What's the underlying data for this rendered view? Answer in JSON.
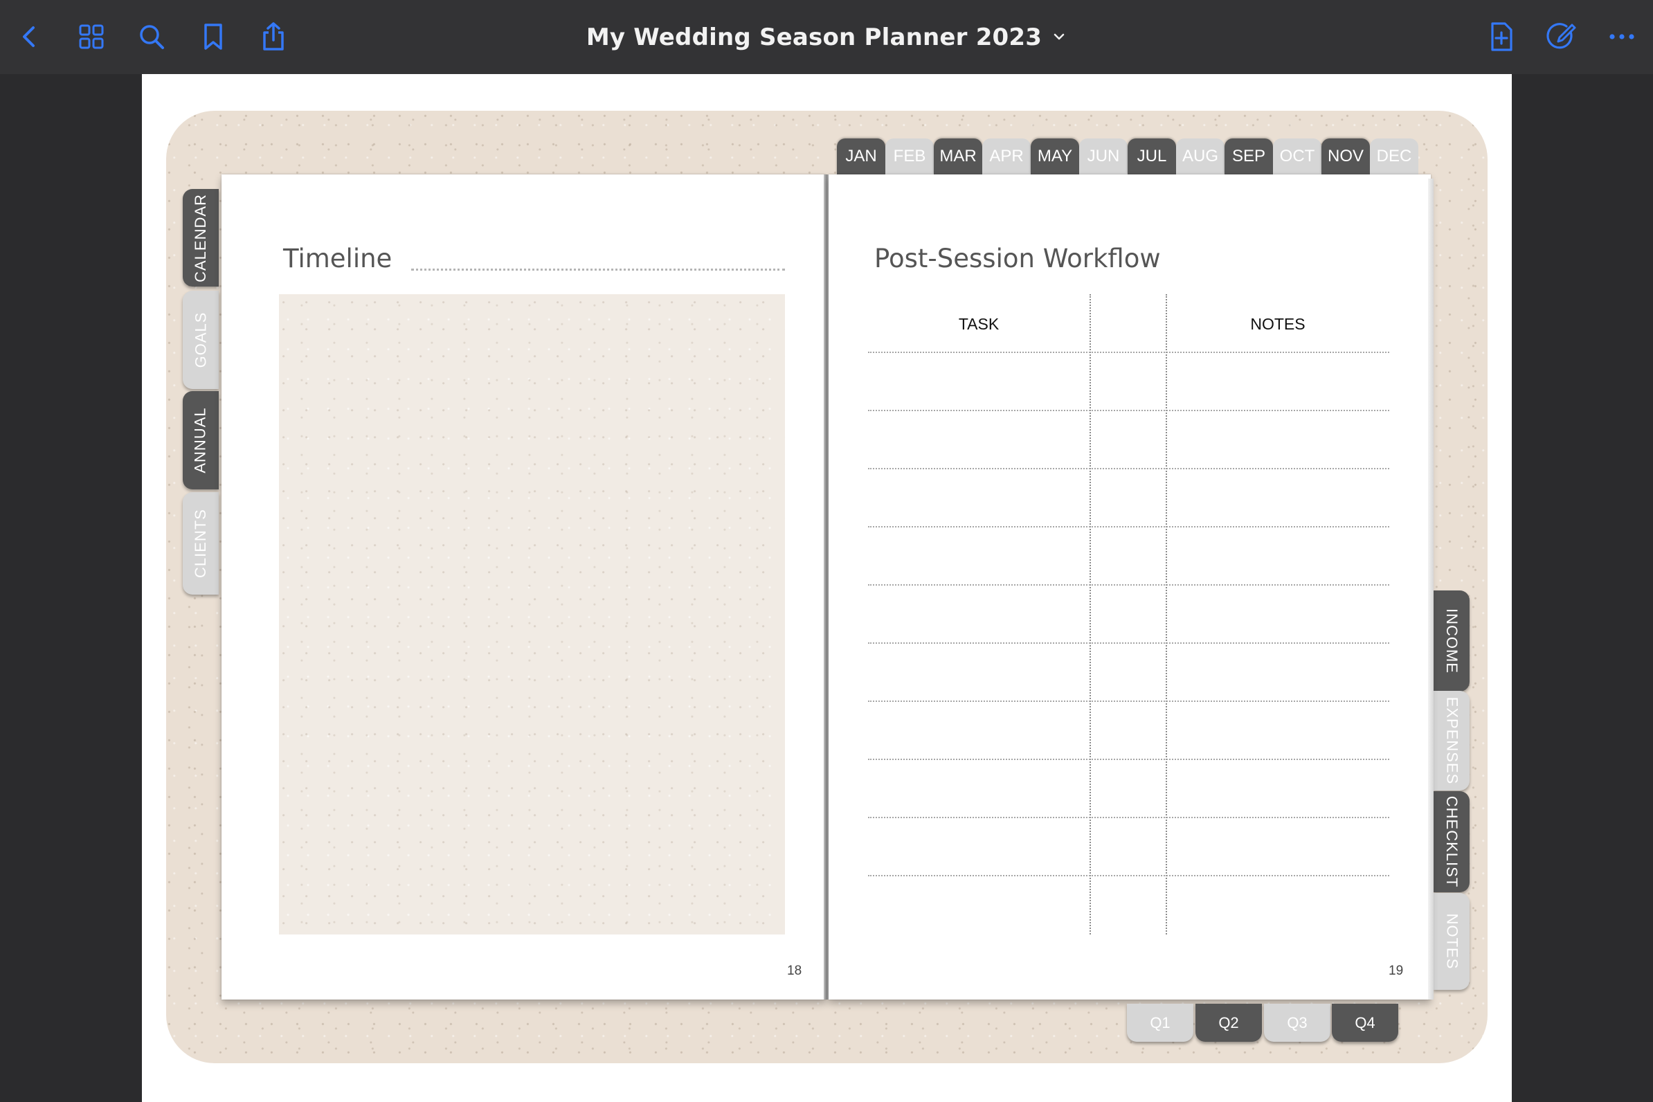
{
  "app": {
    "title": "My Wedding Season Planner 2023",
    "accent_color": "#3478f6",
    "toolbar_left_icons": [
      "back-icon",
      "grid-icon",
      "search-icon",
      "bookmark-icon",
      "share-icon"
    ],
    "toolbar_right_icons": [
      "add-page-icon",
      "edit-icon",
      "more-icon"
    ]
  },
  "months": [
    {
      "label": "JAN",
      "active": true
    },
    {
      "label": "FEB",
      "active": false
    },
    {
      "label": "MAR",
      "active": true
    },
    {
      "label": "APR",
      "active": false
    },
    {
      "label": "MAY",
      "active": true
    },
    {
      "label": "JUN",
      "active": false
    },
    {
      "label": "JUL",
      "active": true
    },
    {
      "label": "AUG",
      "active": false
    },
    {
      "label": "SEP",
      "active": true
    },
    {
      "label": "OCT",
      "active": false
    },
    {
      "label": "NOV",
      "active": true
    },
    {
      "label": "DEC",
      "active": false
    }
  ],
  "left_tabs": [
    {
      "label": "CALENDAR",
      "active": true
    },
    {
      "label": "GOALS",
      "active": false
    },
    {
      "label": "ANNUAL",
      "active": true
    },
    {
      "label": "CLIENTS",
      "active": false
    }
  ],
  "right_tabs": [
    {
      "label": "INCOME",
      "active": true
    },
    {
      "label": "EXPENSES",
      "active": false
    },
    {
      "label": "CHECKLIST",
      "active": true
    },
    {
      "label": "NOTES",
      "active": false
    }
  ],
  "quarters": [
    {
      "label": "Q1",
      "active": false
    },
    {
      "label": "Q2",
      "active": true
    },
    {
      "label": "Q3",
      "active": false
    },
    {
      "label": "Q4",
      "active": true
    }
  ],
  "left_page": {
    "heading": "Timeline",
    "page_number": "18"
  },
  "right_page": {
    "heading": "Post-Session Workflow",
    "columns": [
      "TASK",
      "",
      "NOTES"
    ],
    "row_count": 10,
    "page_number": "19"
  }
}
